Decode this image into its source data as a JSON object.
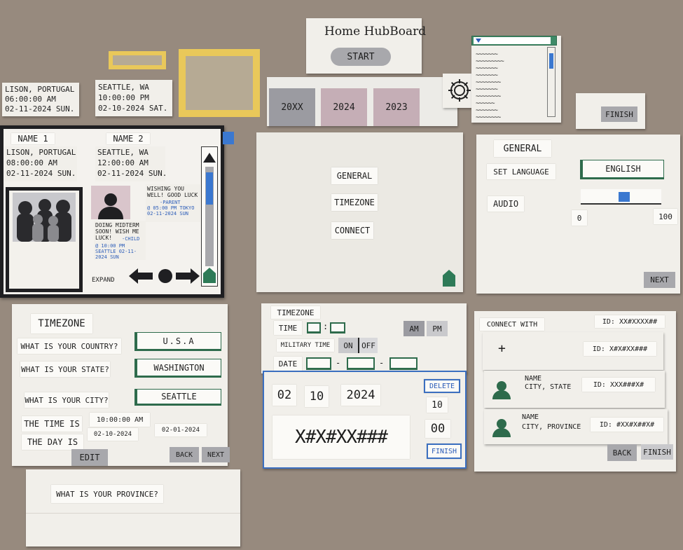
{
  "hub": {
    "title": "Home HubBoard",
    "start": "START"
  },
  "years": [
    "20XX",
    "2024",
    "2023"
  ],
  "dropdown_lines": [
    "~~~~~~~",
    "~~~~~~~~~",
    "~~~~~~~",
    "~~~~~~~",
    "~~~~~~~~",
    "~~~~~~~",
    "~~~~~~~~",
    "~~~~~~",
    "~~~~~~~",
    "~~~~~~~~"
  ],
  "finish_top": "FINISH",
  "clocks": [
    {
      "city": "LISON, PORTUGAL",
      "time": "06:00:00 AM",
      "date": "02-11-2024 SUN."
    },
    {
      "city": "SEATTLE, WA",
      "time": "10:00:00 PM",
      "date": "02-10-2024 SAT."
    }
  ],
  "main": {
    "name1": "NAME 1",
    "name2": "NAME 2",
    "clock1": {
      "city": "LISON, PORTUGAL",
      "time": "08:00:00 AM",
      "date": "02-11-2024 SUN."
    },
    "clock2": {
      "city": "SEATTLE, WA",
      "time": "12:00:00 AM",
      "date": "02-11-2024 SUN."
    },
    "msg1": {
      "text": "WISHING YOU WELL! GOOD LUCK",
      "from": "-PARENT",
      "meta": "@ 05:00 PM TOKYO 02-11-2024 SUN"
    },
    "msg2": {
      "text": "DOING MIDTERM SOON! WISH ME LUCK!",
      "from": "-CHILD",
      "meta": "@ 10:00 PM SEATTLE 02-11-2024 SUN"
    },
    "expand": "EXPAND"
  },
  "settings_menu": {
    "items": [
      "GENERAL",
      "TIMEZONE",
      "CONNECT"
    ]
  },
  "general": {
    "title": "GENERAL",
    "lang_label": "SET LANGUAGE",
    "lang_value": "ENGLISH",
    "audio_label": "AUDIO",
    "audio_min": "0",
    "audio_max": "100",
    "audio_level": 0.55,
    "next": "NEXT"
  },
  "tz1": {
    "title": "TIMEZONE",
    "q_country": "WHAT IS YOUR COUNTRY?",
    "country": "U.S.A",
    "q_state": "WHAT IS YOUR STATE?",
    "state": "WASHINGTON",
    "q_city": "WHAT IS YOUR CITY?",
    "city": "SEATTLE",
    "time_label": "THE TIME IS",
    "time_value": "10:00:00 AM",
    "day_label": "THE DAY IS",
    "date1": "02-10-2024",
    "date2": "02-01-2024",
    "edit": "EDIT",
    "back": "BACK",
    "next": "NEXT"
  },
  "province": "WHAT IS YOUR PROVINCE?",
  "tz2": {
    "title": "TIMEZONE",
    "time": "TIME",
    "colon": ":",
    "am": "AM",
    "pm": "PM",
    "military": "MILITARY TIME",
    "on": "ON",
    "off": "OFF",
    "date": "DATE",
    "dash": "-"
  },
  "picker": {
    "d1": "02",
    "d2": "10",
    "d3": "2024",
    "delete": "DELETE",
    "v1": "10",
    "v2": "00",
    "code": "X#X#XX###",
    "finish": "FINISH"
  },
  "connect": {
    "title": "CONNECT WITH",
    "id_top": "ID: XX#XXXX##",
    "add": "+",
    "id_add": "ID: X#X#XX###",
    "contacts": [
      {
        "name": "NAME",
        "place": "CITY, STATE",
        "id": "ID: XXX###X#"
      },
      {
        "name": "NAME",
        "place": "CITY, PROVINCE",
        "id": "ID: #XX#X##X#"
      }
    ],
    "back": "BACK",
    "finish": "FINISH"
  }
}
